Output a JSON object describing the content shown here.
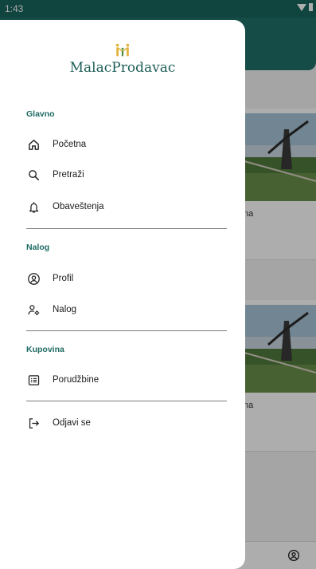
{
  "status_bar": {
    "time": "1:43"
  },
  "app": {
    "name": "MalacProdavac"
  },
  "background": {
    "card1_caption": "na",
    "card2_caption": "na"
  },
  "drawer": {
    "sections": [
      {
        "title": "Glavno",
        "items": [
          {
            "label": "Početna",
            "icon": "home-icon"
          },
          {
            "label": "Pretraži",
            "icon": "search-icon"
          },
          {
            "label": "Obaveštenja",
            "icon": "bell-icon"
          }
        ]
      },
      {
        "title": "Nalog",
        "items": [
          {
            "label": "Profil",
            "icon": "account-circle-icon"
          },
          {
            "label": "Nalog",
            "icon": "account-settings-icon"
          }
        ]
      },
      {
        "title": "Kupovina",
        "items": [
          {
            "label": "Porudžbine",
            "icon": "orders-list-icon"
          }
        ]
      }
    ],
    "logout": {
      "label": "Odjavi se",
      "icon": "logout-icon"
    }
  },
  "colors": {
    "primary": "#1f716a",
    "section_title": "#1f6b64",
    "logo_accent": "#e3b23c"
  }
}
